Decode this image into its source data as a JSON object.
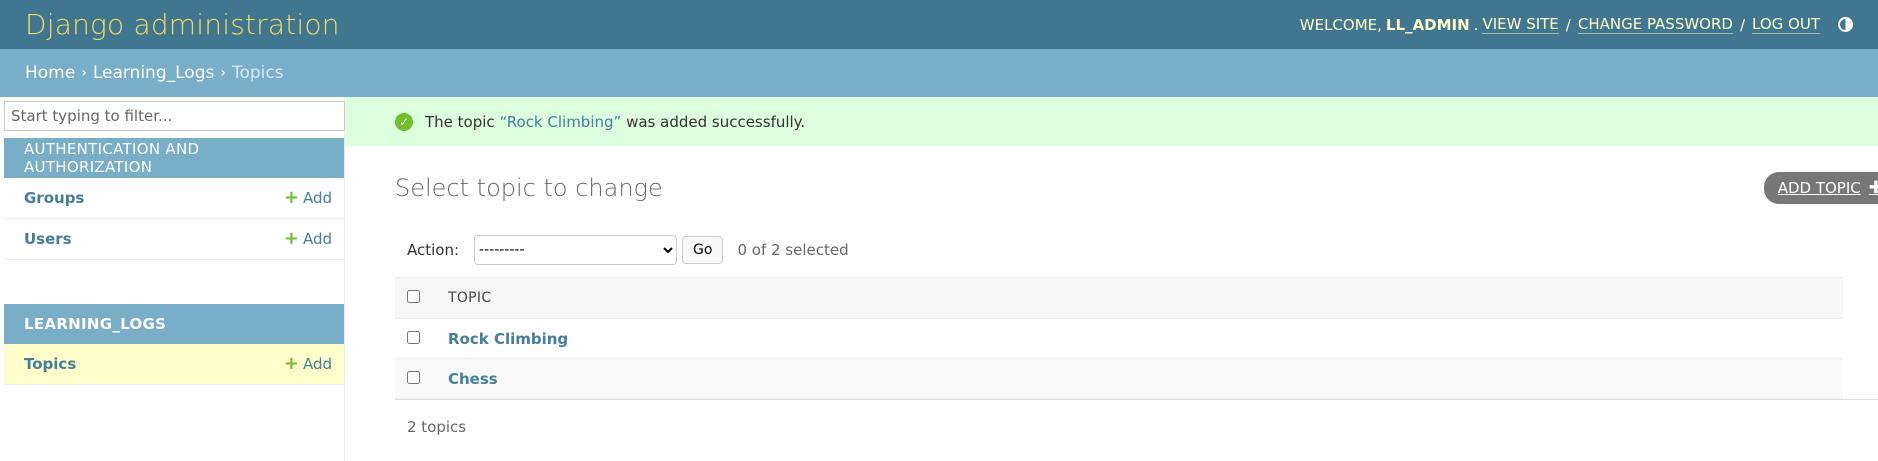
{
  "header": {
    "branding": "Django administration",
    "welcome": "WELCOME,",
    "username": "LL_ADMIN",
    "view_site": "VIEW SITE",
    "change_password": "CHANGE PASSWORD",
    "log_out": "LOG OUT"
  },
  "breadcrumbs": {
    "home": "Home",
    "app": "Learning_Logs",
    "current": "Topics"
  },
  "sidebar": {
    "filter_placeholder": "Start typing to filter...",
    "modules": [
      {
        "caption": "AUTHENTICATION AND AUTHORIZATION",
        "models": [
          {
            "name": "Groups",
            "add": "Add"
          },
          {
            "name": "Users",
            "add": "Add"
          }
        ]
      },
      {
        "caption": "LEARNING_LOGS",
        "models": [
          {
            "name": "Topics",
            "add": "Add"
          }
        ]
      }
    ]
  },
  "message": {
    "prefix": "The topic",
    "link": "“Rock Climbing”",
    "suffix": "was added successfully."
  },
  "content": {
    "title": "Select topic to change",
    "add_button": "ADD TOPIC",
    "action_label": "Action:",
    "action_selected": "---------",
    "go_button": "Go",
    "selection_counter": "0 of 2 selected",
    "column_header": "TOPIC",
    "rows": [
      "Rock Climbing",
      "Chess"
    ],
    "footer": "2 topics"
  },
  "colors": {
    "header_bg": "#417690",
    "branding": "#f5dd5d",
    "breadcrumbs_bg": "#79aec8",
    "success_bg": "#dfdfdf",
    "link": "#447e9b",
    "add_plus": "#70bf2b"
  }
}
